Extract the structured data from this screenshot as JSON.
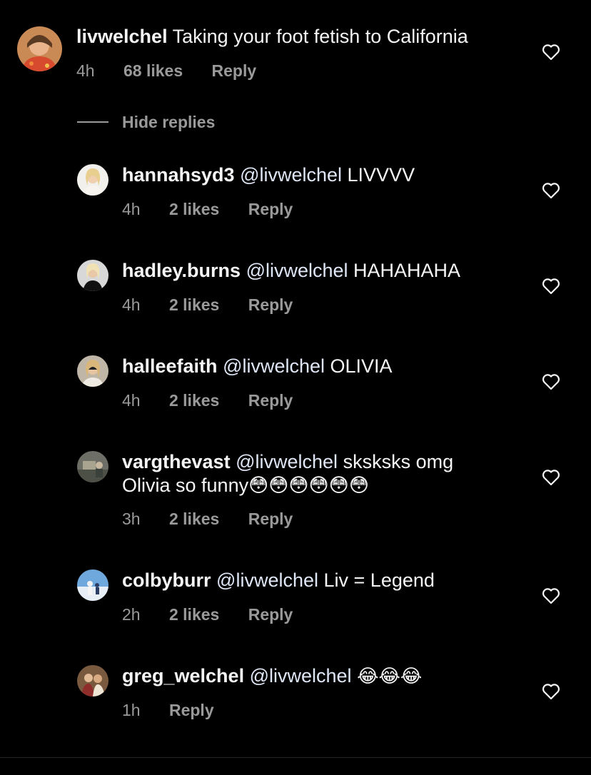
{
  "main_comment": {
    "username": "livwelchel",
    "text": "Taking your foot fetish to California",
    "time": "4h",
    "likes": "68 likes",
    "reply_label": "Reply"
  },
  "hide_replies_label": "Hide replies",
  "replies": [
    {
      "username": "hannahsyd3",
      "mention": "@livwelchel",
      "text": "LIVVVV",
      "time": "4h",
      "likes": "2 likes",
      "reply_label": "Reply"
    },
    {
      "username": "hadley.burns",
      "mention": "@livwelchel",
      "text": "HAHAHAHA",
      "time": "4h",
      "likes": "2 likes",
      "reply_label": "Reply"
    },
    {
      "username": "halleefaith",
      "mention": "@livwelchel",
      "text": "OLIVIA",
      "time": "4h",
      "likes": "2 likes",
      "reply_label": "Reply"
    },
    {
      "username": "vargthevast",
      "mention": "@livwelchel",
      "text": "sksksks omg Olivia so funny😳😳😳😳😳😳",
      "time": "3h",
      "likes": "2 likes",
      "reply_label": "Reply"
    },
    {
      "username": "colbyburr",
      "mention": "@livwelchel",
      "text": "Liv = Legend",
      "time": "2h",
      "likes": "2 likes",
      "reply_label": "Reply"
    },
    {
      "username": "greg_welchel",
      "mention": "@livwelchel",
      "text": "😂😂😂",
      "time": "1h",
      "likes": "",
      "reply_label": "Reply"
    }
  ],
  "icons": {
    "like": "heart-outline-icon"
  },
  "colors": {
    "background": "#000000",
    "text": "#f5f5f5",
    "meta": "#9a9a9a"
  }
}
